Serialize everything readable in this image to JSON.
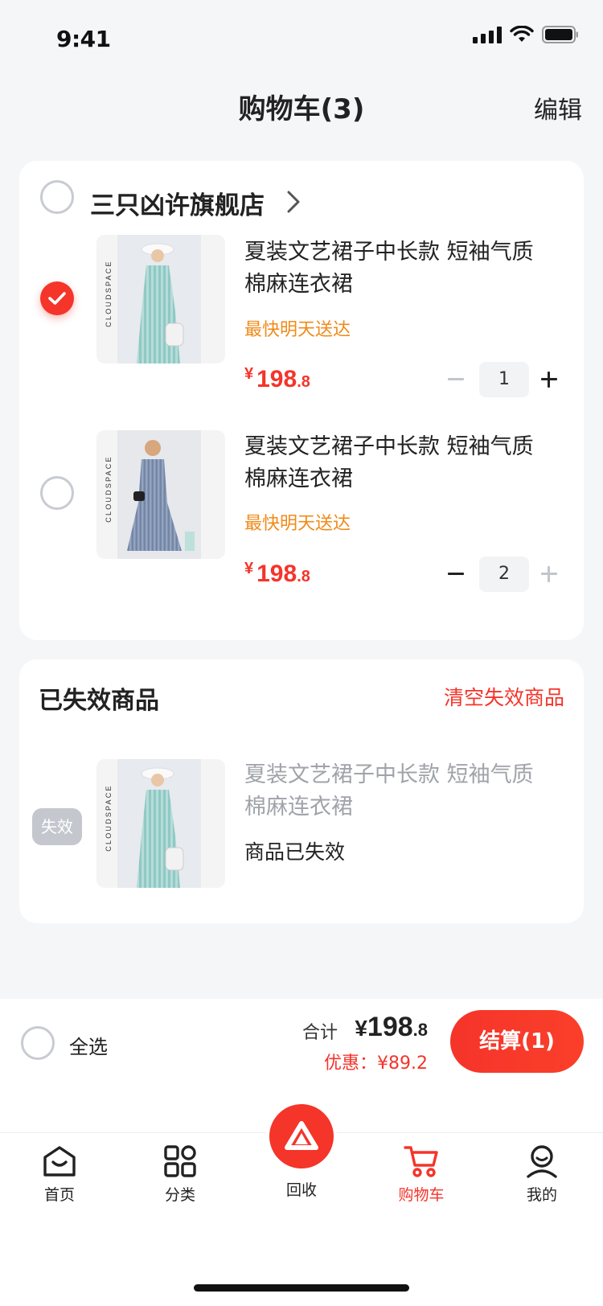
{
  "status_bar": {
    "time": "9:41"
  },
  "nav": {
    "title": "购物车(3)",
    "edit": "编辑"
  },
  "store": {
    "name": "三只凶许旗舰店",
    "items": [
      {
        "title": "夏装文艺裙子中长款 短袖气质棉麻连衣裙",
        "tag": "最快明天送达",
        "currency": "¥",
        "price_int": "198",
        "price_dec": ".8",
        "quantity": "1",
        "checked": true,
        "brand": "CLOUDSPACE"
      },
      {
        "title": "夏装文艺裙子中长款 短袖气质棉麻连衣裙",
        "tag": "最快明天送达",
        "currency": "¥",
        "price_int": "198",
        "price_dec": ".8",
        "quantity": "2",
        "checked": false,
        "brand": "CLOUDSPACE"
      }
    ]
  },
  "invalid": {
    "title": "已失效商品",
    "clear": "清空失效商品",
    "badge": "失效",
    "item_title": "夏装文艺裙子中长款 短袖气质棉麻连衣裙",
    "status": "商品已失效",
    "brand": "CLOUDSPACE"
  },
  "checkout": {
    "select_all": "全选",
    "total_label": "合计",
    "total_currency": "¥",
    "total_int": "198",
    "total_dec": ".8",
    "discount": "优惠：¥89.2",
    "button": "结算(1)"
  },
  "tabbar": {
    "items": [
      {
        "label": "首页",
        "icon": "home-icon"
      },
      {
        "label": "分类",
        "icon": "category-icon"
      },
      {
        "label": "回收",
        "icon": "recycle-icon"
      },
      {
        "label": "购物车",
        "icon": "cart-icon",
        "active": true
      },
      {
        "label": "我的",
        "icon": "profile-icon"
      }
    ]
  },
  "colors": {
    "accent": "#f5342a",
    "tag": "#f08a18",
    "background": "#f5f6f8"
  }
}
